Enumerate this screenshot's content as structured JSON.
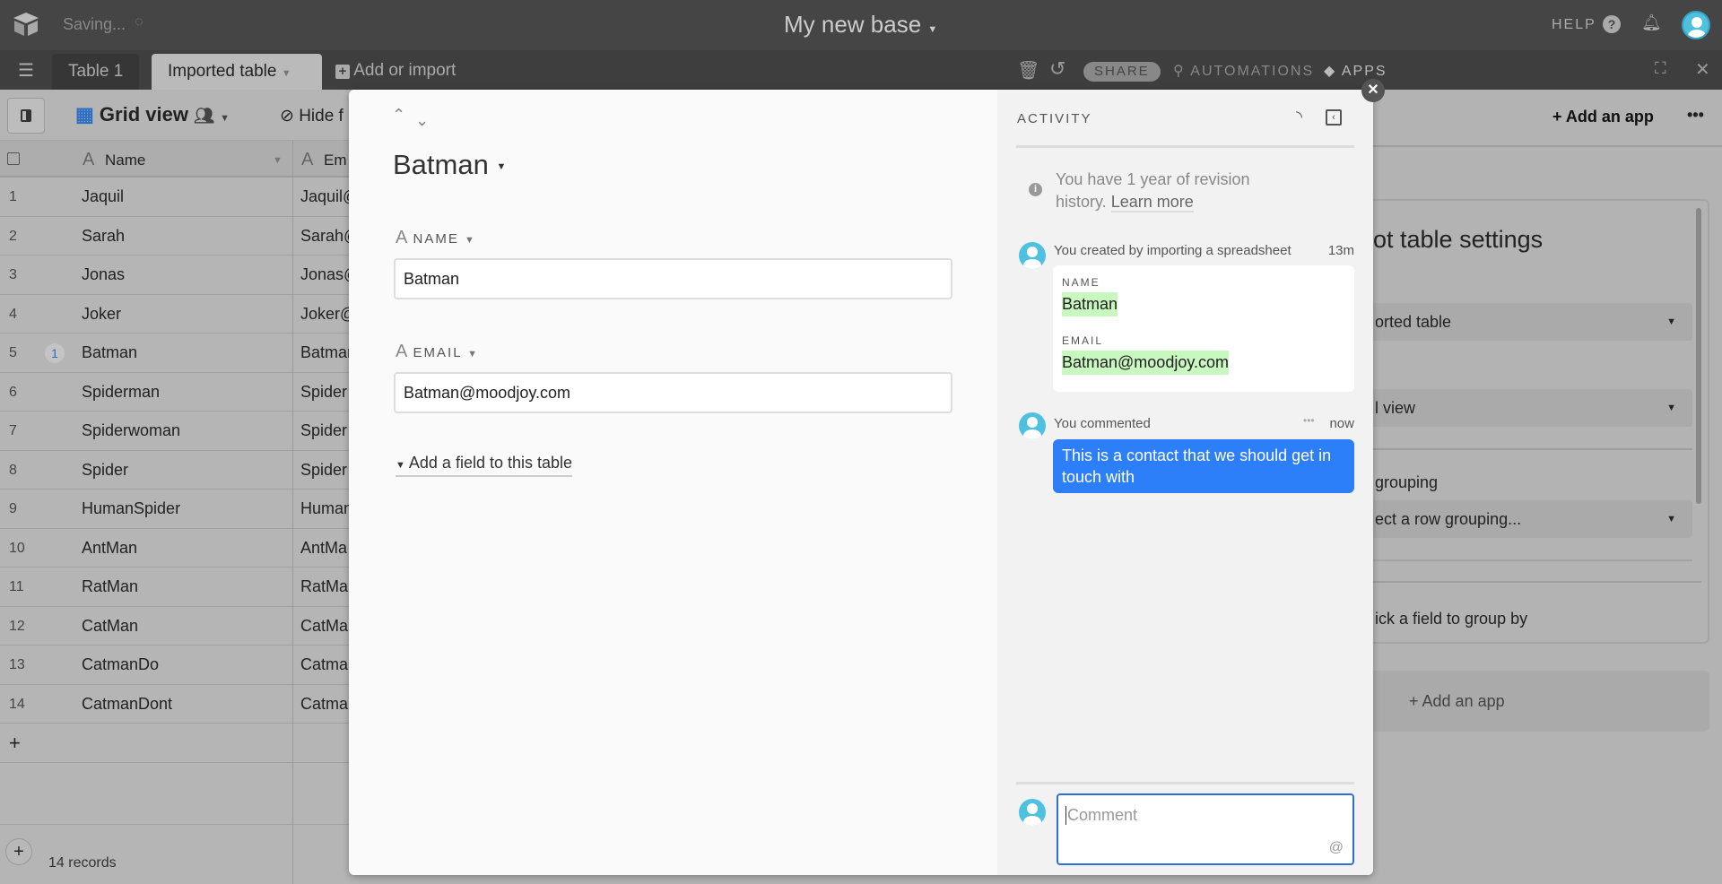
{
  "topbar": {
    "status": "Saving...",
    "base_title": "My new base",
    "help": "HELP"
  },
  "tabs": {
    "items": [
      {
        "label": "Table 1"
      },
      {
        "label": "Imported table"
      }
    ],
    "add": "Add or import",
    "share": "SHARE",
    "automations": "AUTOMATIONS",
    "apps": "APPS"
  },
  "toolbar": {
    "view": "Grid view",
    "hide_fields": "Hide f"
  },
  "grid": {
    "columns": [
      "Name",
      "Em"
    ],
    "rows": [
      {
        "n": "1",
        "name": "Jaquil",
        "email": "Jaquil@"
      },
      {
        "n": "2",
        "name": "Sarah",
        "email": "Sarah@"
      },
      {
        "n": "3",
        "name": "Jonas",
        "email": "Jonas@"
      },
      {
        "n": "4",
        "name": "Joker",
        "email": "Joker@"
      },
      {
        "n": "5",
        "name": "Batman",
        "email": "Batman",
        "comments": "1"
      },
      {
        "n": "6",
        "name": "Spiderman",
        "email": "Spider"
      },
      {
        "n": "7",
        "name": "Spiderwoman",
        "email": "Spider"
      },
      {
        "n": "8",
        "name": "Spider",
        "email": "Spider"
      },
      {
        "n": "9",
        "name": "HumanSpider",
        "email": "Human"
      },
      {
        "n": "10",
        "name": "AntMan",
        "email": "AntMa"
      },
      {
        "n": "11",
        "name": "RatMan",
        "email": "RatMan"
      },
      {
        "n": "12",
        "name": "CatMan",
        "email": "CatMa"
      },
      {
        "n": "13",
        "name": "CatmanDo",
        "email": "Catma"
      },
      {
        "n": "14",
        "name": "CatmanDont",
        "email": "Catma"
      }
    ],
    "add_row": "+",
    "record_count": "14 records"
  },
  "apps_panel": {
    "add_app": "Add an app",
    "settings_title": "ot table settings",
    "table_select": "orted table",
    "view_select": "l view",
    "grouping_label": "grouping",
    "grouping_select": "ect a row grouping...",
    "group_hint": "ick a field to group by",
    "add_app_card": "Add an app"
  },
  "record": {
    "title": "Batman",
    "fields": [
      {
        "label": "NAME",
        "value": "Batman"
      },
      {
        "label": "EMAIL",
        "value": "Batman@moodjoy.com"
      }
    ],
    "add_field": "Add a field to this table"
  },
  "activity": {
    "heading": "ACTIVITY",
    "info_line1": "You have 1 year of revision",
    "info_line2": "history.",
    "learn_more": "Learn more",
    "created": {
      "text": "You created by importing a spreadsheet",
      "time": "13m",
      "fields": [
        {
          "label": "NAME",
          "value": "Batman"
        },
        {
          "label": "EMAIL",
          "value": "Batman@moodjoy.com"
        }
      ]
    },
    "comment": {
      "text": "You commented",
      "time": "now",
      "body": "This is a contact that we should get in touch with"
    },
    "comment_placeholder": "Comment",
    "mention": "@"
  },
  "colors": {
    "accent": "#2d7ff9",
    "highlight": "#c8f7c0",
    "avatar": "#4ec0e0"
  }
}
